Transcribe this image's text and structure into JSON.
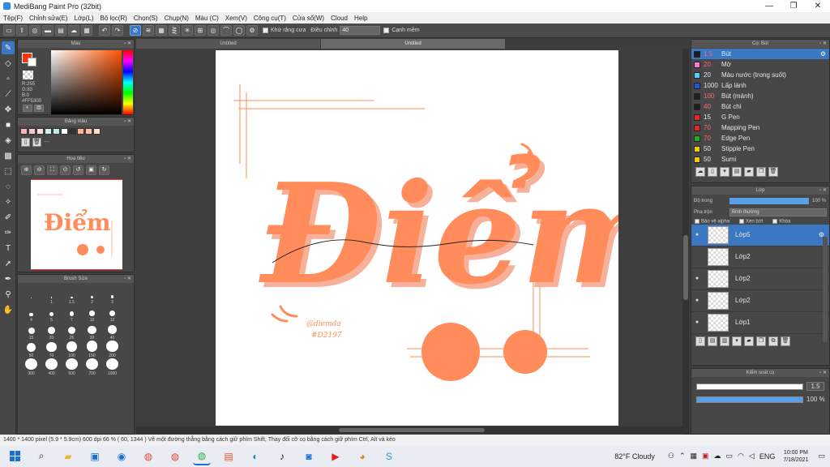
{
  "window": {
    "title": "MediBang Paint Pro (32bit)",
    "minimize": "—",
    "maximize": "❐",
    "close": "✕"
  },
  "menu": [
    "Tệp(F)",
    "Chỉnh sửa(E)",
    "Lớp(L)",
    "Bộ lọc(R)",
    "Chọn(S)",
    "Chụp(N)",
    "Màu (C)",
    "Xem(V)",
    "Công cụ(T)",
    "Cửa sổ(W)",
    "Cloud",
    "Help"
  ],
  "toolbar": {
    "antialias_label": "Khử răng cưa",
    "correction_label": "Điều chỉnh",
    "correction_value": "40",
    "smooth_label": "Cạnh mềm"
  },
  "color_panel": {
    "title": "Màu",
    "r": "R:255",
    "g": "G:83",
    "b": "B:0",
    "hex": "#FF5300"
  },
  "palette_panel": {
    "title": "Bảng màu",
    "placeholder": "---",
    "swatches": [
      "#f7b6b6",
      "#f7c8c8",
      "#fbdede",
      "#c8f0f0",
      "#b8ecec",
      "#ffffff",
      "#333333",
      "#ffb08a",
      "#ffc4a4",
      "#ffdccc"
    ]
  },
  "navigator_panel": {
    "title": "Hoa tiêu"
  },
  "brush_size_panel": {
    "title": "Brush Size",
    "sizes": [
      "",
      "1",
      "1.5",
      "2",
      "3",
      "4",
      "5",
      "7",
      "10",
      "12",
      "15",
      "20",
      "25",
      "30",
      "40",
      "50",
      "70",
      "100",
      "150",
      "200",
      "300",
      "400",
      "500",
      "700",
      "1000"
    ]
  },
  "tabs": [
    "Untitled",
    "Untitled"
  ],
  "brushes_panel": {
    "title": "Cọ: Bút",
    "items": [
      {
        "size": "1.5",
        "name": "Bút",
        "color": "#1e1e1e"
      },
      {
        "size": "20",
        "name": "Mờ",
        "color": "#ff77cc"
      },
      {
        "size": "20",
        "name": "Màu nước (trong suốt)",
        "color": "#55ccff"
      },
      {
        "size": "1000",
        "name": "Lấp lánh",
        "color": "#2255dd"
      },
      {
        "size": "100",
        "name": "Bút (mảnh)",
        "color": "#1e1e1e"
      },
      {
        "size": "40",
        "name": "Bút chì",
        "color": "#1e1e1e"
      },
      {
        "size": "15",
        "name": "G Pen",
        "color": "#ee2222"
      },
      {
        "size": "70",
        "name": "Mapping Pen",
        "color": "#ee2222"
      },
      {
        "size": "70",
        "name": "Edge Pen",
        "color": "#22aa22"
      },
      {
        "size": "50",
        "name": "Stipple Pen",
        "color": "#eecc00"
      },
      {
        "size": "50",
        "name": "Sumi",
        "color": "#eecc00"
      }
    ]
  },
  "layer_panel": {
    "title": "Lớp",
    "opacity_label": "Độ trong",
    "opacity_value": "100 %",
    "blend_label": "Pha trộn",
    "blend_value": "Bình thường",
    "protect_alpha": "Bảo vệ alpha",
    "clipping": "Xén bớt",
    "lock": "Khóa",
    "layers": [
      {
        "name": "Lớp5",
        "visible": true,
        "selected": true
      },
      {
        "name": "Lớp2",
        "visible": false,
        "selected": false
      },
      {
        "name": "Lớp2",
        "visible": true,
        "selected": false
      },
      {
        "name": "Lớp2",
        "visible": true,
        "selected": false
      },
      {
        "name": "Lớp1",
        "visible": true,
        "selected": false
      }
    ]
  },
  "brush_control": {
    "title": "Kiểm soát cọ",
    "size_value": "1.5",
    "opacity_value": "100 %"
  },
  "canvas": {
    "lettering": "Điểm",
    "signature": "@diemda",
    "subtext": "#D2197"
  },
  "status": {
    "text": "1400 * 1400 pixel   (5.9 * 5.9cm)   600 dpi   66 %   ( 60, 1344 )   Vẽ một đường thẳng bằng cách giữ phím Shift, Thay đổi cỡ cọ bằng cách giữ phím Ctrl, Alt và kéo"
  },
  "taskbar": {
    "weather": "82°F  Cloudy",
    "lang": "ENG",
    "time": "10:00 PM",
    "date": "7/18/2021"
  },
  "colors": {
    "accent": "#3b78c4",
    "lettering": "#ff8c5a",
    "lettering_shadow": "#f7b09a"
  }
}
